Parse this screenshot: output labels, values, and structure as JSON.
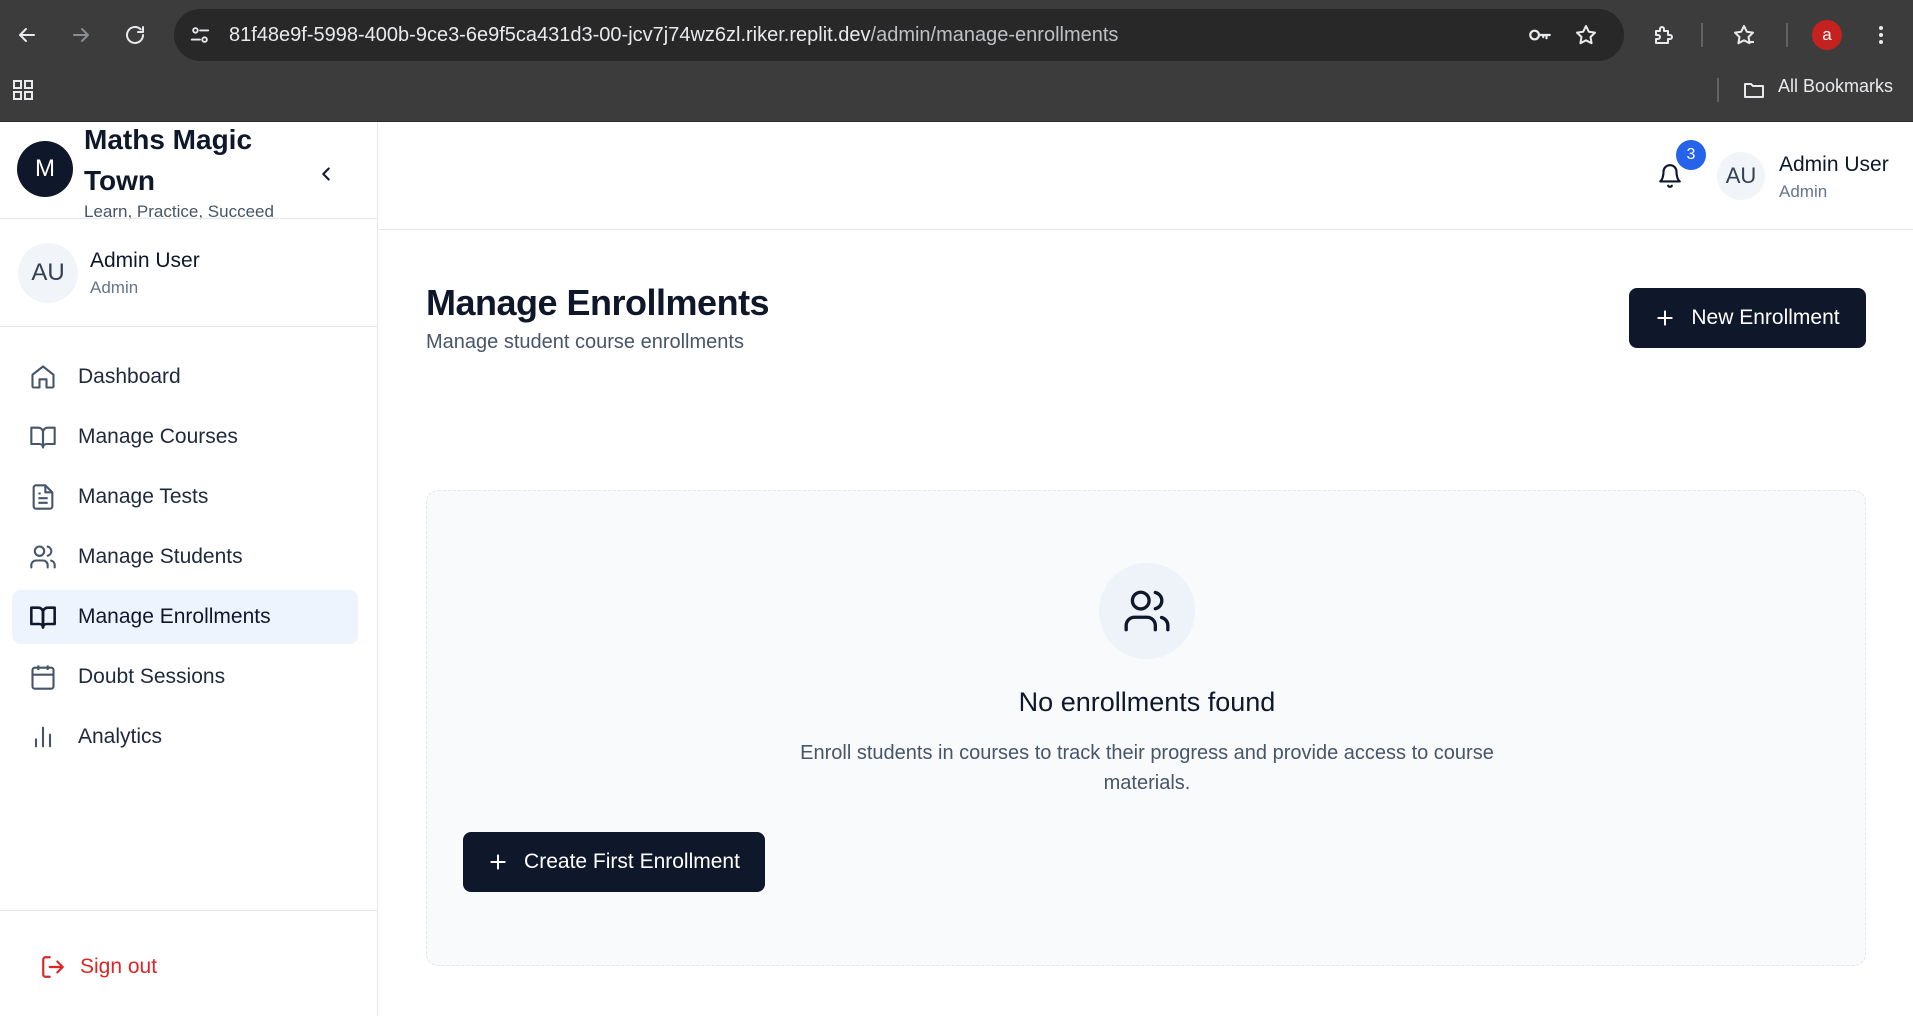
{
  "browser": {
    "url_host": "81f48e9f-5998-400b-9ce3-6e9f5ca431d3-00-jcv7j74wz6zl.riker.replit.dev",
    "url_path": "/admin/manage-enrollments",
    "profile_initial": "a",
    "bookmarks_label": "All Bookmarks",
    "icons": [
      "back-icon",
      "forward-icon",
      "reload-icon",
      "site-info-icon",
      "key-icon",
      "star-icon",
      "extensions-icon",
      "bookmark-star-icon",
      "menu-icon",
      "apps-icon",
      "folder-icon"
    ]
  },
  "sidebar": {
    "brand_initial": "M",
    "brand_name": "Maths Magic Town",
    "tagline": "Learn, Practice, Succeed",
    "user": {
      "initials": "AU",
      "name": "Admin User",
      "role": "Admin"
    },
    "nav": [
      {
        "label": "Dashboard",
        "icon": "home-icon"
      },
      {
        "label": "Manage Courses",
        "icon": "book-icon"
      },
      {
        "label": "Manage Tests",
        "icon": "file-text-icon"
      },
      {
        "label": "Manage Students",
        "icon": "users-icon"
      },
      {
        "label": "Manage Enrollments",
        "icon": "book-open-icon",
        "active": true
      },
      {
        "label": "Doubt Sessions",
        "icon": "calendar-icon"
      },
      {
        "label": "Analytics",
        "icon": "bar-chart-icon"
      }
    ],
    "signout_label": "Sign out"
  },
  "header": {
    "notification_count": "3",
    "user": {
      "initials": "AU",
      "name": "Admin User",
      "role": "Admin"
    }
  },
  "main": {
    "title": "Manage Enrollments",
    "subtitle": "Manage student course enrollments",
    "new_button": "New Enrollment",
    "empty": {
      "title": "No enrollments found",
      "description": "Enroll students in courses to track their progress and provide access to course materials.",
      "button": "Create First Enrollment"
    }
  },
  "colors": {
    "brand_dark": "#0f172a",
    "active_nav_bg": "#eef4fe",
    "signout_red": "#dc2626",
    "badge_blue": "#2563eb",
    "chrome_bg": "#3c3c3c"
  }
}
